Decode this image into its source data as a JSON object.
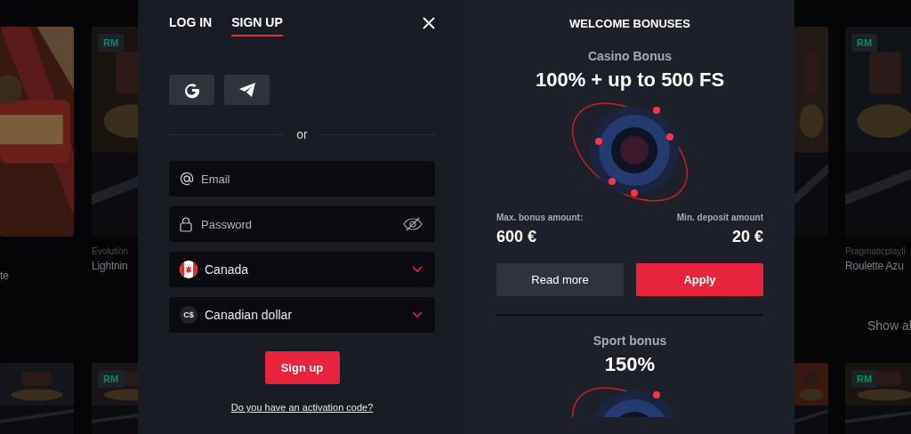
{
  "games_left": [
    {
      "top": {
        "kind": "picture",
        "title": "te"
      },
      "bottom": {
        "kind": "picture"
      }
    },
    {
      "top": {
        "kind": "picture",
        "badge": "RM",
        "provider": "Evolution",
        "title": "Lightnin"
      },
      "bottom": {
        "kind": "picture",
        "badge": "RM"
      }
    }
  ],
  "games_right": [
    {
      "top": {
        "kind": "picture"
      },
      "bottom": {
        "kind": "picture"
      }
    },
    {
      "top": {
        "kind": "picture",
        "badge": "RM",
        "provider": "Pragmaticplayli",
        "title": "Roulette Azu"
      },
      "bottom": {
        "kind": "picture",
        "badge": "RM"
      }
    }
  ],
  "show_all": "Show al",
  "auth": {
    "tabs": [
      {
        "label": "LOG IN",
        "selected": false
      },
      {
        "label": "SIGN UP",
        "selected": true
      }
    ],
    "social_buttons": [
      {
        "kind": "google"
      },
      {
        "kind": "telegram"
      }
    ],
    "divider": "or",
    "fields": [
      {
        "kind": "email",
        "placeholder": "Email"
      },
      {
        "kind": "password",
        "placeholder": "Password"
      },
      {
        "kind": "country",
        "value": "Canada"
      },
      {
        "kind": "currency",
        "symbol": "C$",
        "value": "Canadian dollar"
      }
    ],
    "submit": "Sign up",
    "activation_link": "Do you have an activation code?"
  },
  "bonuses": {
    "title": "WELCOME BONUSES",
    "items": [
      {
        "category": "Casino Bonus",
        "headline": "100% + up to 500 FS",
        "max_label": "Max. bonus amount:",
        "max_value": "600 €",
        "min_label": "Min. deposit amount",
        "min_value": "20 €",
        "buttons": [
          {
            "kind": "secondary",
            "label": "Read more"
          },
          {
            "kind": "primary",
            "label": "Apply"
          }
        ]
      },
      {
        "category": "Sport bonus",
        "headline": "150%"
      }
    ]
  }
}
